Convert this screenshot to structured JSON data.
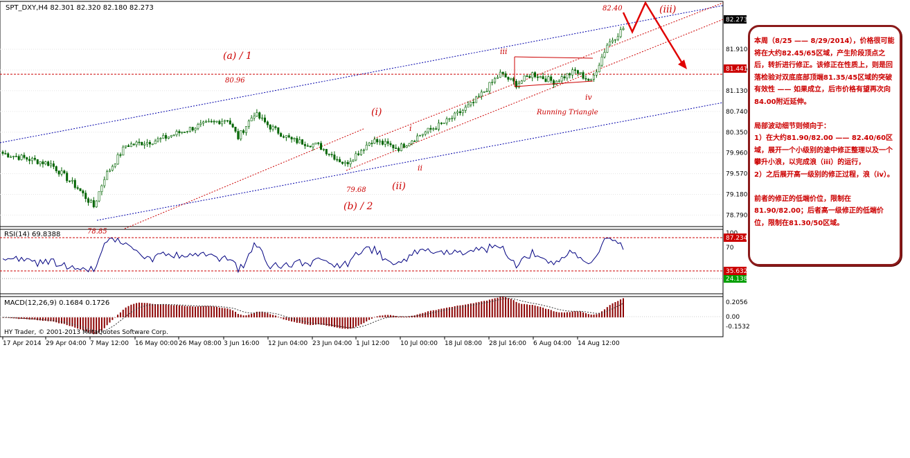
{
  "header": {
    "symbol_line": "SPT_DXY,H4  82.301 82.320 82.180 82.273"
  },
  "colors": {
    "candles": "#006400",
    "price_tag": "#000000",
    "level_tag": "#cc0000",
    "channel": "#0000aa",
    "annotation": "#cc0000",
    "rsi_line": "#000080",
    "macd_bars": "#8b0000"
  },
  "chart_data": [
    {
      "type": "candlestick",
      "title": "SPT_DXY,H4",
      "ohlc_last": {
        "open": 82.301,
        "high": 82.32,
        "low": 82.18,
        "close": 82.273
      },
      "ylim": [
        78.6,
        82.55
      ],
      "price_ticks": [
        "81.910",
        "81.520",
        "81.130",
        "80.740",
        "80.350",
        "79.960",
        "79.570",
        "79.180",
        "78.790"
      ],
      "price_tick_values": [
        81.91,
        81.52,
        81.13,
        80.74,
        80.35,
        79.96,
        79.57,
        79.18,
        78.79
      ],
      "x_tick_labels": [
        "17 Apr 2014",
        "29 Apr 04:00",
        "7 May 12:00",
        "16 May 00:00",
        "26 May 08:00",
        "3 Jun 16:00",
        "12 Jun 04:00",
        "23 Jun 04:00",
        "1 Jul 12:00",
        "10 Jul 00:00",
        "18 Jul 08:00",
        "28 Jul 16:00",
        "6 Aug 04:00",
        "14 Aug 12:00"
      ],
      "current_price": "82.273",
      "level": {
        "label": "81.441",
        "value": 81.441
      },
      "anchors": [
        {
          "i": 0,
          "v": 79.95
        },
        {
          "i": 18,
          "v": 79.75
        },
        {
          "i": 28,
          "v": 79.3
        },
        {
          "i": 34,
          "v": 78.95
        },
        {
          "i": 38,
          "v": 79.5
        },
        {
          "i": 46,
          "v": 80.1
        },
        {
          "i": 58,
          "v": 80.2
        },
        {
          "i": 72,
          "v": 80.45
        },
        {
          "i": 84,
          "v": 80.6
        },
        {
          "i": 88,
          "v": 80.25
        },
        {
          "i": 94,
          "v": 80.7
        },
        {
          "i": 100,
          "v": 80.45
        },
        {
          "i": 108,
          "v": 80.2
        },
        {
          "i": 118,
          "v": 80.1
        },
        {
          "i": 128,
          "v": 79.75
        },
        {
          "i": 138,
          "v": 80.2
        },
        {
          "i": 148,
          "v": 80.05
        },
        {
          "i": 156,
          "v": 80.3
        },
        {
          "i": 166,
          "v": 80.55
        },
        {
          "i": 176,
          "v": 80.9
        },
        {
          "i": 186,
          "v": 81.45
        },
        {
          "i": 192,
          "v": 81.25
        },
        {
          "i": 198,
          "v": 81.45
        },
        {
          "i": 206,
          "v": 81.3
        },
        {
          "i": 214,
          "v": 81.5
        },
        {
          "i": 220,
          "v": 81.3
        },
        {
          "i": 226,
          "v": 82.0
        },
        {
          "i": 232,
          "v": 82.3
        }
      ],
      "annotations": [
        {
          "text": "(a) / 1"
        },
        {
          "text": "80.96"
        },
        {
          "text": "78.85"
        },
        {
          "text": "(i)"
        },
        {
          "text": "i"
        },
        {
          "text": "ii"
        },
        {
          "text": "(ii)"
        },
        {
          "text": "79.68"
        },
        {
          "text": "(b) / 2"
        },
        {
          "text": "iii"
        },
        {
          "text": "iv"
        },
        {
          "text": "Running Triangle"
        },
        {
          "text": "82.40"
        },
        {
          "text": "(iii)"
        }
      ]
    },
    {
      "type": "line",
      "title": "RSI(14) 69.8388",
      "ylim": [
        0,
        100
      ],
      "ticks": [
        "100",
        "70"
      ],
      "levels": [
        "87.234",
        "35.632",
        "24.138"
      ],
      "level_values": [
        87.234,
        35.632,
        24.138
      ]
    },
    {
      "type": "bar",
      "title": "MACD(12,26,9) 0.1684 0.1726",
      "ylim": [
        -0.1532,
        0.2056
      ],
      "ticks": [
        "0.2056",
        "0.00",
        "-0.1532"
      ],
      "copyright": "HY Trader, © 2001-2013 MetaQuotes Software Corp."
    }
  ],
  "note": {
    "p1": "本周（8/25 —— 8/29/2014），价格很可能将在大约82.45/65区域，产生阶段顶点之后，转折进行修正。该修正在性质上，则是回落检验对双底底部顶端81.35/45区域的突破有效性 —— 如果成立，后市价格有望再次向84.00附近延伸。",
    "p2_title": "局部波动细节则倾向于：",
    "p2_item1": "1）在大约81.90/82.00 —— 82.40/60区域，展开一个小级别的途中修正整理以及一个攀升小浪，以完成浪（iii）的运行，",
    "p2_item2": "2）之后展开高一级别的修正过程，浪（iv）。",
    "p3": "前者的修正的低端价位，限制在81.90/82.00；后者高一级修正的低端价位，限制在81.30/50区域。"
  }
}
